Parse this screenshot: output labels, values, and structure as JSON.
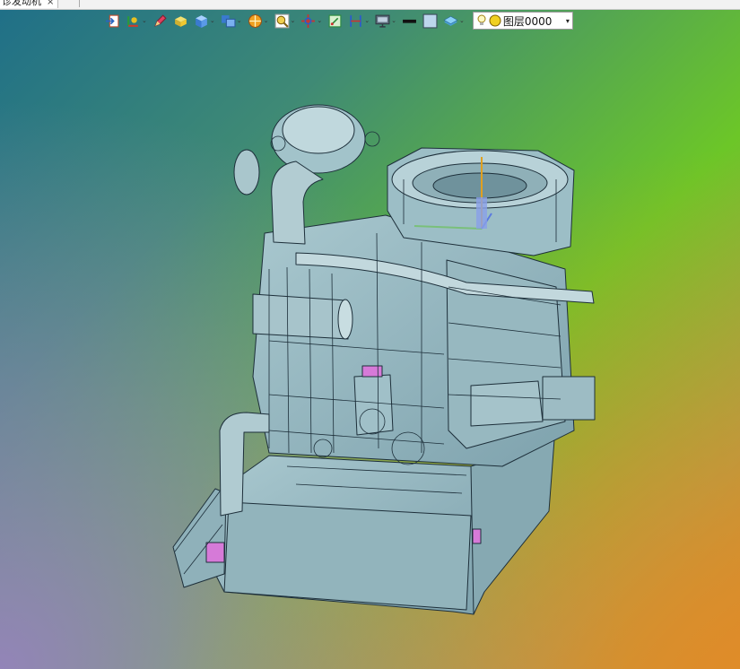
{
  "tabs": [
    {
      "label": "诊发动机",
      "close_glyph": "×"
    }
  ],
  "toolbar": {
    "buttons": [
      {
        "id": "exit",
        "icon": "exit-icon",
        "dropdown": false
      },
      {
        "id": "coordinate",
        "icon": "coordinate-system-icon",
        "dropdown": true
      },
      {
        "id": "sketch",
        "icon": "pencil-icon",
        "dropdown": false
      },
      {
        "id": "solid",
        "icon": "solid-box-icon",
        "dropdown": false
      },
      {
        "id": "view-orient",
        "icon": "view-cube-icon",
        "dropdown": true
      },
      {
        "id": "views",
        "icon": "multi-view-icon",
        "dropdown": true
      },
      {
        "id": "render-mode",
        "icon": "render-sphere-icon",
        "dropdown": true
      },
      {
        "id": "zoom",
        "icon": "zoom-icon",
        "dropdown": true
      },
      {
        "id": "triad",
        "icon": "triad-icon",
        "dropdown": true
      },
      {
        "id": "section",
        "icon": "section-view-icon",
        "dropdown": false
      },
      {
        "id": "measure",
        "icon": "measure-icon",
        "dropdown": true
      },
      {
        "id": "display",
        "icon": "display-monitor-icon",
        "dropdown": true
      },
      {
        "id": "line-style",
        "icon": "line-style-icon",
        "dropdown": false
      },
      {
        "id": "face-color",
        "icon": "face-color-icon",
        "dropdown": false
      },
      {
        "id": "layers",
        "icon": "layer-stack-icon",
        "dropdown": true
      }
    ],
    "layer_selector": {
      "value": "图层0000",
      "icon": "lightbulb-icon",
      "status_icon": "layer-status-icon",
      "dropdown_glyph": "▾"
    }
  },
  "colors": {
    "accent_green": "#6fd21e",
    "accent_orange": "#e0892a",
    "accent_purple": "#9a88c4",
    "model_fill": "#8fb4bd",
    "model_edge": "#1d2f3a"
  }
}
